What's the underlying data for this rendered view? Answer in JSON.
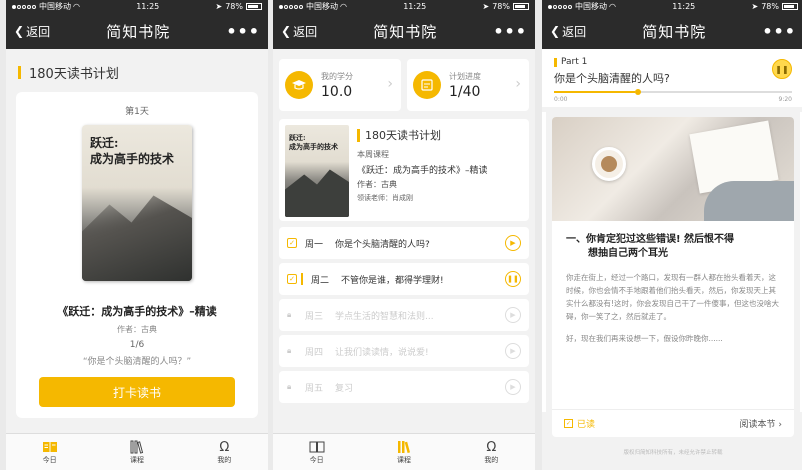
{
  "status": {
    "carrier": "中国移动",
    "time": "11:25",
    "battery": "78%"
  },
  "nav": {
    "back_label": "返回",
    "title": "简知书院",
    "more": "•••"
  },
  "screen1": {
    "plan_title": "180天读书计划",
    "day": "第1天",
    "book_cover_line1": "跃迁:",
    "book_cover_line2": "成为高手的技术",
    "book_title": "《跃迁：成为高手的技术》–精读",
    "author": "作者：古典",
    "progress": "1/6",
    "quote": "“你是个头脑清醒的人吗？”",
    "checkin_label": "打卡读书"
  },
  "tabs": [
    {
      "label": "今日",
      "icon": "book-open-icon"
    },
    {
      "label": "课程",
      "icon": "library-icon"
    },
    {
      "label": "我的",
      "icon": "profile-icon"
    }
  ],
  "screen2": {
    "stat1": {
      "label": "我的学分",
      "value": "10.0"
    },
    "stat2": {
      "label": "计划进度",
      "value": "1/40"
    },
    "course": {
      "plan_title": "180天读书计划",
      "week_label": "本周课程",
      "book": "《跃迁：成为高手的技术》–精读",
      "author": "作者：古典",
      "teacher": "领读老师：肖成刚",
      "cover_line1": "跃迁:",
      "cover_line2": "成为高手的技术"
    },
    "lessons": [
      {
        "day": "周一",
        "title": "你是个头脑清醒的人吗?",
        "state": "done"
      },
      {
        "day": "周二",
        "title": "不管你是谁，都得学理财!",
        "state": "playing"
      },
      {
        "day": "周三",
        "title": "学点生活的智慧和法则...",
        "state": "locked"
      },
      {
        "day": "周四",
        "title": "让我们读读情，说说爱!",
        "state": "locked"
      },
      {
        "day": "周五",
        "title": "复习",
        "state": "locked"
      }
    ]
  },
  "screen3": {
    "part": "Part 1",
    "player_title": "你是个头脑清醒的人吗?",
    "time_start": "0:00",
    "time_end": "9:20",
    "progress": 0.34,
    "heading_line1": "一、你肯定犯过这些错误! 然后恨不得",
    "heading_line2": "想抽自己两个耳光",
    "body1": "你走在街上，经过一个路口，发现有一群人都在抬头看着天，这时候，你也会情不手地跟着他们抬头看天，然后，你发现天上其实什么都没有!这时，你会发现自己干了一件傻事，但这也没啥大碍，你一笑了之，然后就走了。",
    "body2": "好，现在我们再来设想一下，假设你昨晚你......",
    "done_label": "已读",
    "read_label": "阅读本节",
    "copyright": "版权归简知科技所有，未经允许禁止转载"
  }
}
